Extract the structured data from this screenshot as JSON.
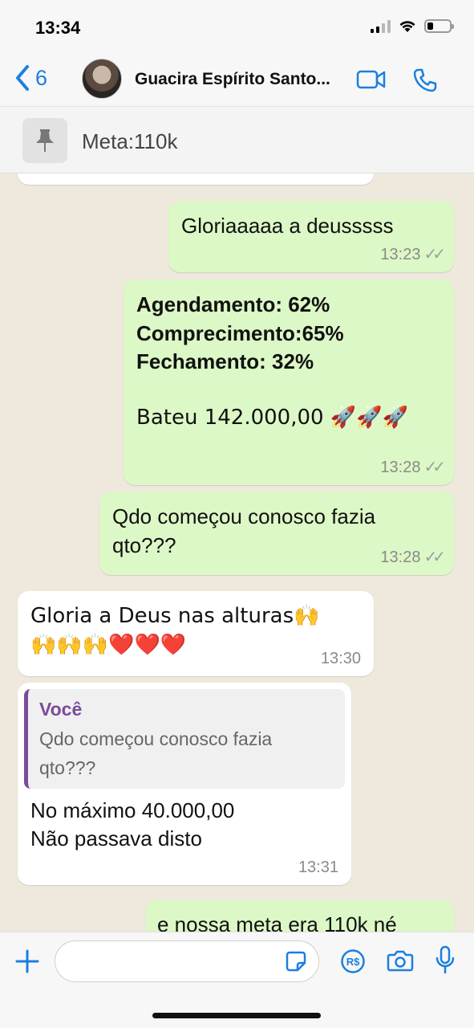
{
  "status_bar": {
    "time": "13:34"
  },
  "header": {
    "back_count": "6",
    "contact_name": "Guacira Espírito Santo...",
    "accent_color": "#1a7fe0"
  },
  "pinned": {
    "text": "Meta:110k"
  },
  "messages": [
    {
      "direction": "out",
      "text": "Gloriaaaaa a deusssss",
      "time": "13:23"
    },
    {
      "direction": "out",
      "bold_lines": [
        "Agendamento: 62%",
        "Comprecimento:65%",
        "Fechamento: 32%"
      ],
      "text": "Bateu 142.000,00 🚀🚀🚀",
      "time": "13:28"
    },
    {
      "direction": "out",
      "lines": [
        "Qdo começou conosco fazia",
        "qto???"
      ],
      "time": "13:28"
    },
    {
      "direction": "in",
      "lines": [
        "Gloria a Deus nas alturas🙌",
        "🙌🙌🙌❤️❤️❤️"
      ],
      "time": "13:30"
    },
    {
      "direction": "in",
      "quote": {
        "author": "Você",
        "lines": [
          "Qdo começou conosco fazia",
          "qto???"
        ]
      },
      "lines": [
        "No máximo 40.000,00",
        "Não passava disto"
      ],
      "time": "13:31"
    },
    {
      "direction": "out",
      "text": "e nossa meta era 110k né"
    }
  ],
  "colors": {
    "outgoing_bubble": "#dcf8c6",
    "incoming_bubble": "#ffffff",
    "quote_accent": "#7c4a9c"
  }
}
